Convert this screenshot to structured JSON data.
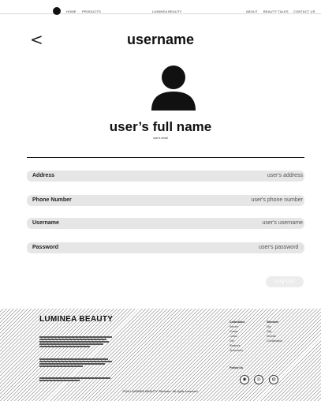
{
  "nav": {
    "home": "HOME",
    "products": "PRODUCTS",
    "brand": "LUMINEA BEAUTY",
    "about": "ABOUT",
    "beauty_talks": "BEAUTY TALKS",
    "contact": "CONTACT US"
  },
  "profile": {
    "back_glyph": "<",
    "title": "username",
    "full_name": "user’s full name",
    "email": "user's email"
  },
  "fields": [
    {
      "label": "Address",
      "value": "user's address"
    },
    {
      "label": "Phone Number",
      "value": "user's phone number"
    },
    {
      "label": "Username",
      "value": "user's username"
    },
    {
      "label": "Password",
      "value": "user's password"
    }
  ],
  "password_toggle_icon": "eye-icon",
  "logout_label": "Log Out",
  "footer": {
    "brand": "LUMINEA BEAUTY",
    "col1": {
      "heading": "Collections",
      "items": [
        "Serum",
        "Cream",
        "Lotion",
        "Gel",
        "Essence",
        "Sunscreen"
      ]
    },
    "col2": {
      "heading": "Skincare",
      "items": [
        "Dry",
        "Oily",
        "Normal",
        "Combination"
      ]
    },
    "follow": "Follow Us",
    "copyright": "2024 LUMINEA BEAUTY Skincare. All rights reserved."
  }
}
